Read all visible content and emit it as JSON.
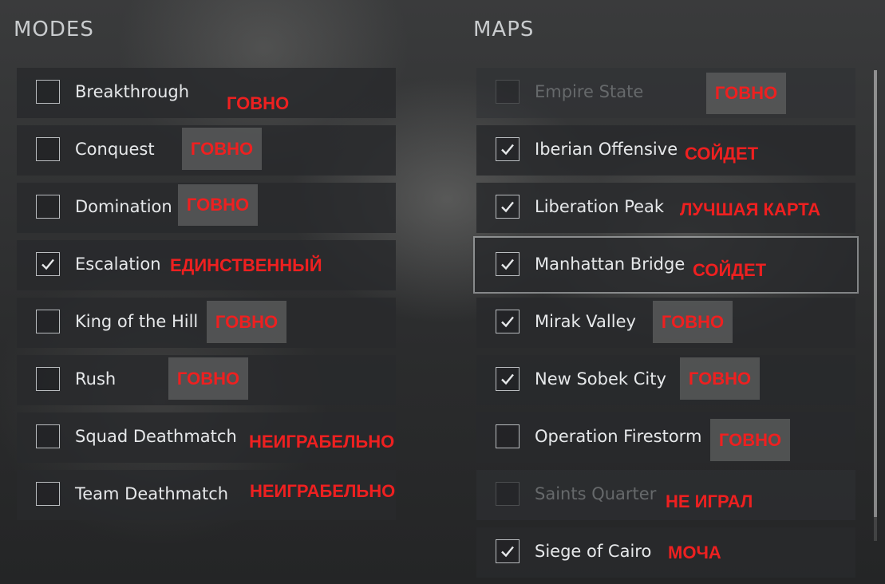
{
  "modes": {
    "heading": "MODES",
    "items": [
      {
        "label": "Breakthrough",
        "checked": false,
        "note": "ГОВНО"
      },
      {
        "label": "Conquest",
        "checked": false,
        "note": "ГОВНО"
      },
      {
        "label": "Domination",
        "checked": false,
        "note": "ГОВНО"
      },
      {
        "label": "Escalation",
        "checked": true,
        "note": "ЕДИНСТВЕННЫЙ"
      },
      {
        "label": "King of the Hill",
        "checked": false,
        "note": "ГОВНО"
      },
      {
        "label": "Rush",
        "checked": false,
        "note": "ГОВНО"
      },
      {
        "label": "Squad Deathmatch",
        "checked": false,
        "note": "НЕИГРАБЕЛЬНО"
      },
      {
        "label": "Team Deathmatch",
        "checked": false,
        "note": "НЕИГРАБЕЛЬНО"
      }
    ]
  },
  "maps": {
    "heading": "MAPS",
    "items": [
      {
        "label": "Empire State",
        "checked": false,
        "disabled": true,
        "note": "ГОВНО"
      },
      {
        "label": "Iberian Offensive",
        "checked": true,
        "note": "СОЙДЕТ"
      },
      {
        "label": "Liberation Peak",
        "checked": true,
        "note": "ЛУЧШАЯ КАРТА"
      },
      {
        "label": "Manhattan Bridge",
        "checked": true,
        "selected": true,
        "note": "СОЙДЕТ"
      },
      {
        "label": "Mirak Valley",
        "checked": true,
        "note": "ГОВНО"
      },
      {
        "label": "New Sobek City",
        "checked": true,
        "note": "ГОВНО"
      },
      {
        "label": "Operation Firestorm",
        "checked": false,
        "note": "ГОВНО"
      },
      {
        "label": "Saints Quarter",
        "checked": false,
        "disabled": true,
        "note": "НЕ ИГРАЛ"
      },
      {
        "label": "Siege of Cairo",
        "checked": true,
        "note": "МОЧА"
      }
    ]
  },
  "colors": {
    "note_text": "#ee2020",
    "label_text": "#e6e8ea",
    "disabled_text": "#66696b",
    "row_bg": "#282a2c"
  },
  "icons": {
    "check": "check-icon"
  }
}
